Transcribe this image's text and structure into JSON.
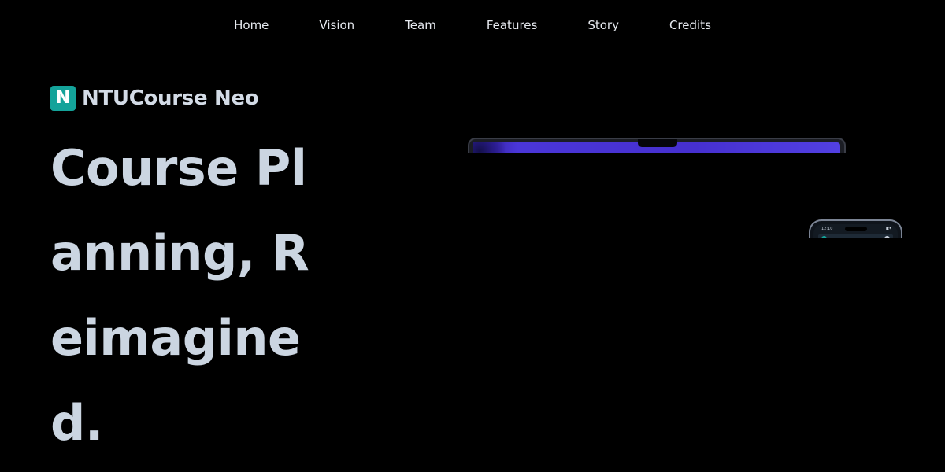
{
  "nav": {
    "items": [
      {
        "label": "Home"
      },
      {
        "label": "Vision"
      },
      {
        "label": "Team"
      },
      {
        "label": "Features"
      },
      {
        "label": "Story"
      },
      {
        "label": "Credits"
      }
    ]
  },
  "brand": {
    "logo_letter": "N",
    "name": "NTUCourse Neo",
    "logo_color": "#14a39a"
  },
  "hero": {
    "headline": "Course Planning, Reimagined."
  },
  "phone": {
    "time": "12:10"
  },
  "colors": {
    "background": "#000000",
    "headline": "#cbd5e1",
    "laptop_screen": "#4630d0"
  }
}
